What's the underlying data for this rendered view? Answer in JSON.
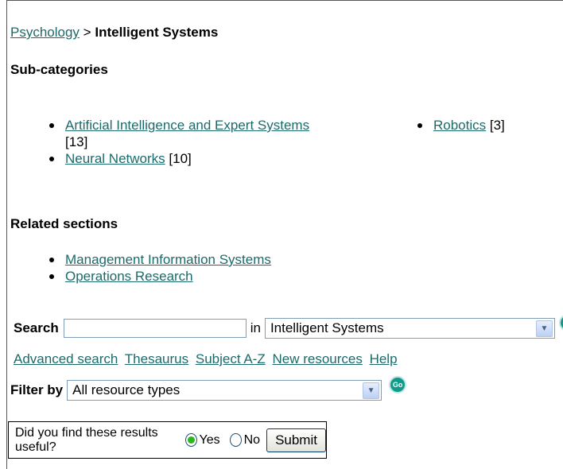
{
  "breadcrumb": {
    "parent": "Psychology",
    "separator": ">",
    "current": "Intelligent Systems"
  },
  "subcategories": {
    "heading": "Sub-categories",
    "col1": [
      {
        "label": "Artificial Intelligence and Expert Systems",
        "count": "[13]"
      },
      {
        "label": "Neural Networks",
        "count": "[10]"
      }
    ],
    "col2": [
      {
        "label": "Robotics",
        "count": "[3]"
      }
    ]
  },
  "related": {
    "heading": "Related sections",
    "items": [
      "Management Information Systems",
      "Operations Research"
    ]
  },
  "search": {
    "label": "Search",
    "value": "",
    "in_label": "in",
    "scope": "Intelligent Systems",
    "go": "Go"
  },
  "links": [
    "Advanced search",
    "Thesaurus",
    "Subject A-Z",
    "New resources",
    "Help"
  ],
  "filter": {
    "label": "Filter by",
    "value": "All resource types",
    "go": "Go"
  },
  "feedback": {
    "question": "Did you find these results useful?",
    "yes": "Yes",
    "no": "No",
    "selected": "Yes",
    "submit": "Submit"
  }
}
